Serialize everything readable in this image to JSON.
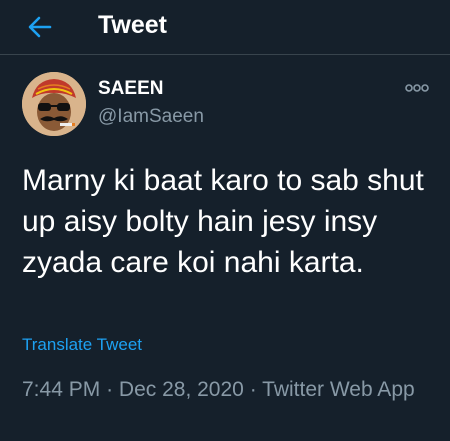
{
  "header": {
    "back_icon": "arrow-left-icon",
    "title": "Tweet"
  },
  "author": {
    "display_name": "SAEEN",
    "handle": "@IamSaeen",
    "avatar_icon": "cartoon-man-avatar"
  },
  "more_icon": "more-options-icon",
  "tweet": {
    "text": "Marny ki baat karo to sab shut up aisy bolty hain jesy insy zyada care koi nahi karta.",
    "translate_label": "Translate Tweet",
    "time": "7:44 PM",
    "separator": "·",
    "date": "Dec 28, 2020",
    "source": "Twitter Web App"
  },
  "colors": {
    "background": "#15202b",
    "accent": "#1da1f2",
    "secondary_text": "#8899a6",
    "divider": "#38444d"
  }
}
